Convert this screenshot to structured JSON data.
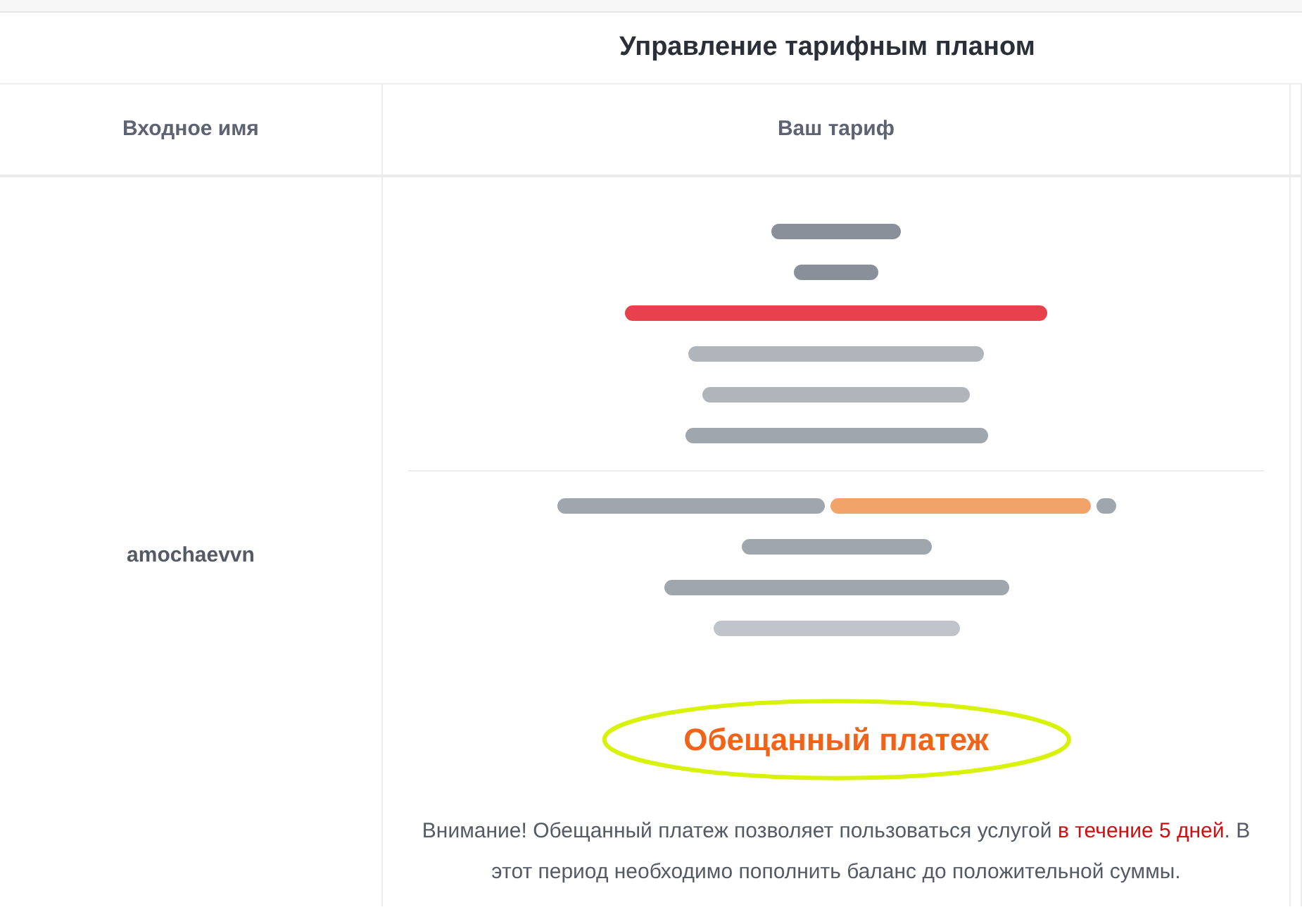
{
  "table": {
    "title": "Управление тарифным планом",
    "columns": [
      "Входное имя",
      "Ваш тариф"
    ],
    "row": {
      "login": "amochaevvn",
      "tariff_lines": [
        {
          "segments": [
            {
              "color": "#8a9099"
            }
          ]
        },
        {
          "segments": [
            {
              "color": "#8a9099"
            }
          ]
        },
        {
          "segments": [
            {
              "color": "#e8414b"
            }
          ]
        },
        {
          "segments": [
            {
              "color": "#b0b5bc"
            }
          ]
        },
        {
          "segments": [
            {
              "color": "#b0b5bc"
            }
          ]
        },
        {
          "segments": [
            {
              "color": "#a0a6ae"
            }
          ]
        }
      ],
      "balance_lines": [
        {
          "segments": [
            {
              "color": "#a0a6ae"
            },
            {
              "color": "#f2a36a"
            },
            {
              "color": "#a0a6ae"
            }
          ]
        },
        {
          "segments": [
            {
              "color": "#a0a6ae"
            }
          ]
        },
        {
          "segments": [
            {
              "color": "#a0a6ae"
            }
          ]
        },
        {
          "segments": [
            {
              "color": "#c0c4ca"
            }
          ]
        }
      ],
      "promise_button": {
        "label": "Обещанный платеж",
        "circled": true
      },
      "notice": [
        {
          "text": "Внимание! Обещанный платеж позволяет пользоваться услугой ",
          "kind": "normal"
        },
        {
          "text": "в течение 5 дней",
          "kind": "alert"
        },
        {
          "text": ". В этот период необходимо пополнить баланс до положительной суммы.",
          "kind": "normal"
        }
      ]
    }
  }
}
